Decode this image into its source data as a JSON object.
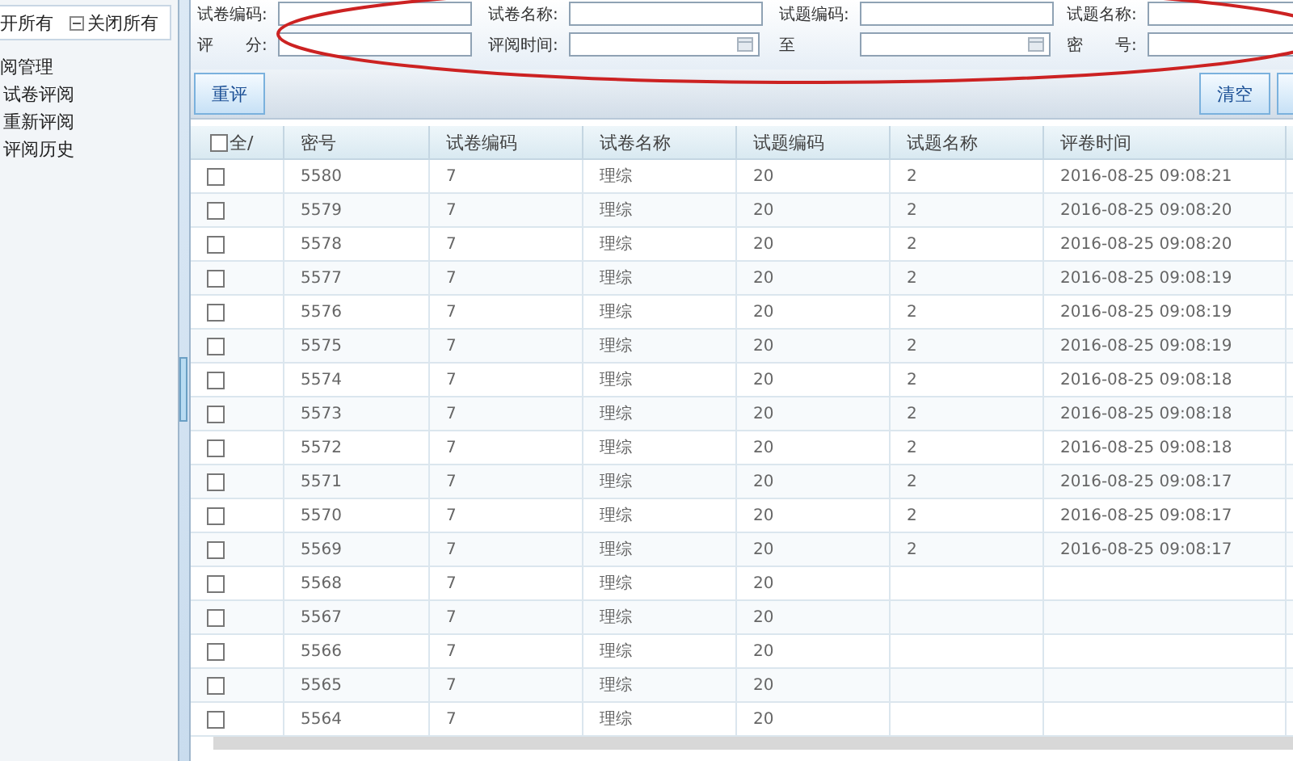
{
  "sidebar": {
    "expand_all": "开所有",
    "collapse_all": "关闭所有",
    "tree": [
      {
        "label": "阅管理",
        "children": [
          {
            "label": "试卷评阅"
          },
          {
            "label": "重新评阅"
          },
          {
            "label": "评阅历史"
          }
        ]
      }
    ]
  },
  "search": {
    "rows": [
      [
        {
          "label": "试卷编码:",
          "kind": "text"
        },
        {
          "label": "试卷名称:",
          "kind": "text"
        },
        {
          "label": "试题编码:",
          "kind": "text"
        },
        {
          "label": "试题名称:",
          "kind": "text"
        }
      ],
      [
        {
          "label": "评　　分:",
          "kind": "text"
        },
        {
          "label": "评阅时间:",
          "kind": "date"
        },
        {
          "label": "至",
          "kind": "date"
        },
        {
          "label": "密　　号:",
          "kind": "text"
        }
      ]
    ]
  },
  "toolbar": {
    "left_buttons": [
      "重评"
    ],
    "right_buttons": [
      "清空"
    ],
    "edge_button": true
  },
  "table": {
    "select_all": {
      "label": "全/",
      "checked": false
    },
    "columns": [
      "密号",
      "试卷编码",
      "试卷名称",
      "试题编码",
      "试题名称",
      "评卷时间"
    ],
    "rows": [
      {
        "checked": false,
        "cells": [
          "5580",
          "7",
          "理综",
          "20",
          "2",
          "2016-08-25 09:08:21"
        ]
      },
      {
        "checked": false,
        "cells": [
          "5579",
          "7",
          "理综",
          "20",
          "2",
          "2016-08-25 09:08:20"
        ]
      },
      {
        "checked": false,
        "cells": [
          "5578",
          "7",
          "理综",
          "20",
          "2",
          "2016-08-25 09:08:20"
        ]
      },
      {
        "checked": false,
        "cells": [
          "5577",
          "7",
          "理综",
          "20",
          "2",
          "2016-08-25 09:08:19"
        ]
      },
      {
        "checked": false,
        "cells": [
          "5576",
          "7",
          "理综",
          "20",
          "2",
          "2016-08-25 09:08:19"
        ]
      },
      {
        "checked": false,
        "cells": [
          "5575",
          "7",
          "理综",
          "20",
          "2",
          "2016-08-25 09:08:19"
        ]
      },
      {
        "checked": false,
        "cells": [
          "5574",
          "7",
          "理综",
          "20",
          "2",
          "2016-08-25 09:08:18"
        ]
      },
      {
        "checked": false,
        "cells": [
          "5573",
          "7",
          "理综",
          "20",
          "2",
          "2016-08-25 09:08:18"
        ]
      },
      {
        "checked": false,
        "cells": [
          "5572",
          "7",
          "理综",
          "20",
          "2",
          "2016-08-25 09:08:18"
        ]
      },
      {
        "checked": false,
        "cells": [
          "5571",
          "7",
          "理综",
          "20",
          "2",
          "2016-08-25 09:08:17"
        ]
      },
      {
        "checked": false,
        "cells": [
          "5570",
          "7",
          "理综",
          "20",
          "2",
          "2016-08-25 09:08:17"
        ]
      },
      {
        "checked": false,
        "cells": [
          "5569",
          "7",
          "理综",
          "20",
          "2",
          "2016-08-25 09:08:17"
        ]
      },
      {
        "checked": false,
        "cells": [
          "5568",
          "7",
          "理综",
          "20"
        ]
      },
      {
        "checked": false,
        "cells": [
          "5567",
          "7",
          "理综",
          "20"
        ]
      },
      {
        "checked": false,
        "cells": [
          "5566",
          "7",
          "理综",
          "20"
        ]
      },
      {
        "checked": false,
        "cells": [
          "5565",
          "7",
          "理综",
          "20"
        ]
      },
      {
        "checked": false,
        "cells": [
          "5564",
          "7",
          "理综",
          "20"
        ]
      }
    ]
  },
  "annotation": {
    "kind": "ellipse"
  }
}
